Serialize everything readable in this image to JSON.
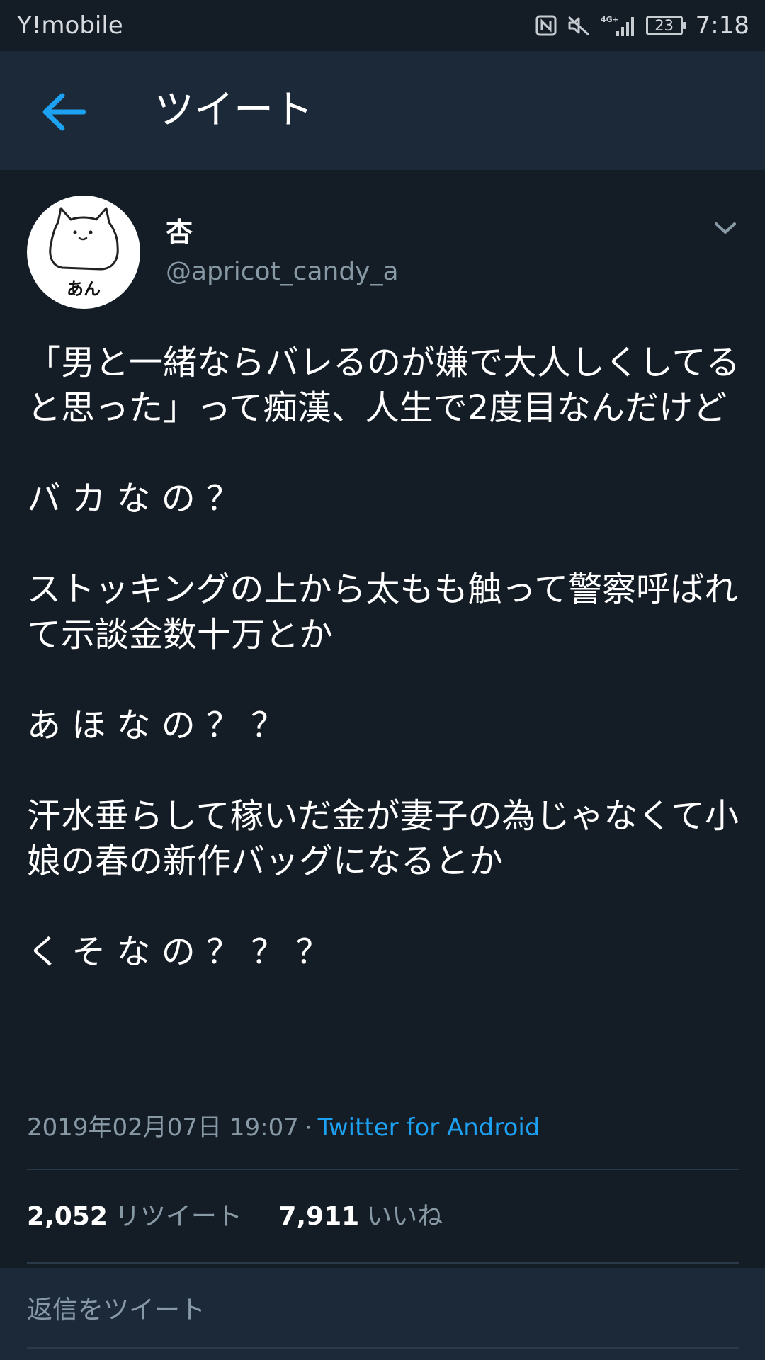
{
  "status_bar": {
    "carrier": "Y!mobile",
    "network": "4G+",
    "battery_level": "23",
    "time": "7:18"
  },
  "header": {
    "title": "ツイート"
  },
  "tweet": {
    "avatar_text": "あん",
    "user_name": "杏",
    "user_handle": "@apricot_candy_a",
    "text": "「男と一緒ならバレるのが嫌で大人しくしてると思った」って痴漢、人生で2度目なんだけど\n\nバ カ な の ？\n\nストッキングの上から太もも触って警察呼ばれて示談金数十万とか\n\nあ ほ な の ？ ？\n\n汗水垂らして稼いだ金が妻子の為じゃなくて小娘の春の新作バッグになるとか\n\nく そ な の ？ ？ ？",
    "timestamp": "2019年02月07日 19:07",
    "separator": "·",
    "source": "Twitter for Android",
    "retweet_count": "2,052",
    "retweet_label": "リツイート",
    "like_count": "7,911",
    "like_label": "いいね"
  },
  "reply": {
    "placeholder": "返信をツイート"
  },
  "colors": {
    "background": "#141d26",
    "header_background": "#1c2938",
    "accent": "#1da1f2",
    "secondary_text": "#8899a6"
  },
  "icons": {
    "back": "arrow-left-icon",
    "caret": "chevron-down-icon",
    "nfc": "nfc-icon",
    "mute": "mute-icon",
    "signal": "signal-icon",
    "battery": "battery-icon"
  }
}
